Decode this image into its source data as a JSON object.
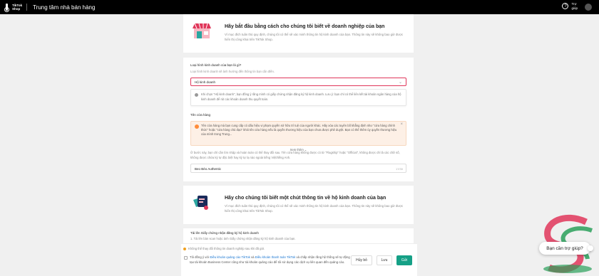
{
  "topbar": {
    "logo_line1": "TikTok",
    "logo_line2": "Shop",
    "title": "Trung tâm nhà bán hàng",
    "help_line1": "Trợ",
    "help_line2": "giúp"
  },
  "section_business": {
    "title": "Hãy bắt đầu bằng cách cho chúng tôi biết về doanh nghiệp của bạn",
    "desc": "Vì mục đích tuân thủ quy định, chúng tôi có thể sẽ xác minh thông tin hộ kinh doanh của bạn. Thông tin này sẽ không bao giờ được hiển thị công khai trên TikTok Shop."
  },
  "business_form": {
    "type_label": "Loại hình kinh doanh của bạn là gì?",
    "type_sublabel": "Loại hình kinh doanh sẽ ảnh hưởng đến thông tin bạn cần điền.",
    "type_value": "Hộ kinh doanh",
    "type_info": "Khi chọn \"Hộ kinh doanh\", bạn đồng ý rằng mình có giấy chứng nhận đăng ký hộ kinh doanh. Lưu ý: bạn chỉ có thể liên kết tài khoản ngân hàng của hộ kinh doanh để rút các khoản doanh thu quyết toán.",
    "shop_name_label": "Tên cửa hàng",
    "shop_warning": "Tên cửa hàng mà bạn cung cấp có dấu hiệu vi phạm quyền sở hữu trí tuệ của người khác. Hãy xóa các tuyên bố khẳng định như \"cửa hàng chính thức\" hoặc \"cửa hàng chủ đạo\" khỏi tên cửa hàng nếu là quyền thương hiệu của bạn chưa được phê duyệt. Bạn có thể thêm ủy quyền thương hiệu của mình trong Trung...",
    "see_more": "Xem thêm",
    "shop_note": "Ở bước này, bạn chỉ cần tìm nhập và hoàn toàn có thể thay đổi sau. Tên cửa hàng không được có từ \"Flagship\" hoặc \"Official\", không được chỉ là các chữ số, không được chứa ký tự đặc biệt hay ký tự lạ nào ngoài tiếng Việt/tiếng Anh.",
    "shop_name_value": "Beo Béo Authentic",
    "shop_name_count": "17/30"
  },
  "section_household": {
    "title": "Hãy cho chúng tôi biết một chút thông tin về hộ kinh doanh của bạn",
    "desc": "Vì mục đích tuân thủ quy định, chúng tôi có thể sẽ xác minh thông tin hộ kinh doanh của bạn. Thông tin này sẽ không bao giờ được hiển thị công khai trên TikTok Shop."
  },
  "upload": {
    "label": "Tải lên Giấy chứng nhận đăng ký hộ kinh doanh",
    "sub": "1. Tải lên bản scan hoặc ảnh Giấy chứng nhận đăng ký hộ kinh doanh của bạn."
  },
  "footer": {
    "warning": "Không thể thay đổi thông tin doanh nghiệp sau khi đã gửi.",
    "terms_prefix": "Tôi đồng ý với ",
    "terms_link1": "Điều khoản quảng cáo TikTok",
    "terms_and": " và ",
    "terms_link2": "Điều khoản thanh toán TikTok",
    "terms_suffix": " và chấp nhận rằng hệ thống sẽ tự động tạo tài khoản Business Center cũng như tài khoản quảng cáo để tôi sử dụng các dịch vụ liên quan đến quảng cáo.",
    "cancel": "Hủy bỏ",
    "save": "Lưu",
    "send": "Gửi"
  },
  "help_bubble": "Bạn cần trợ giúp?",
  "colors": {
    "accent": "#15a086",
    "error_border": "#e0365a",
    "link": "#1976d2",
    "warning_bg": "#fdf0e6"
  }
}
